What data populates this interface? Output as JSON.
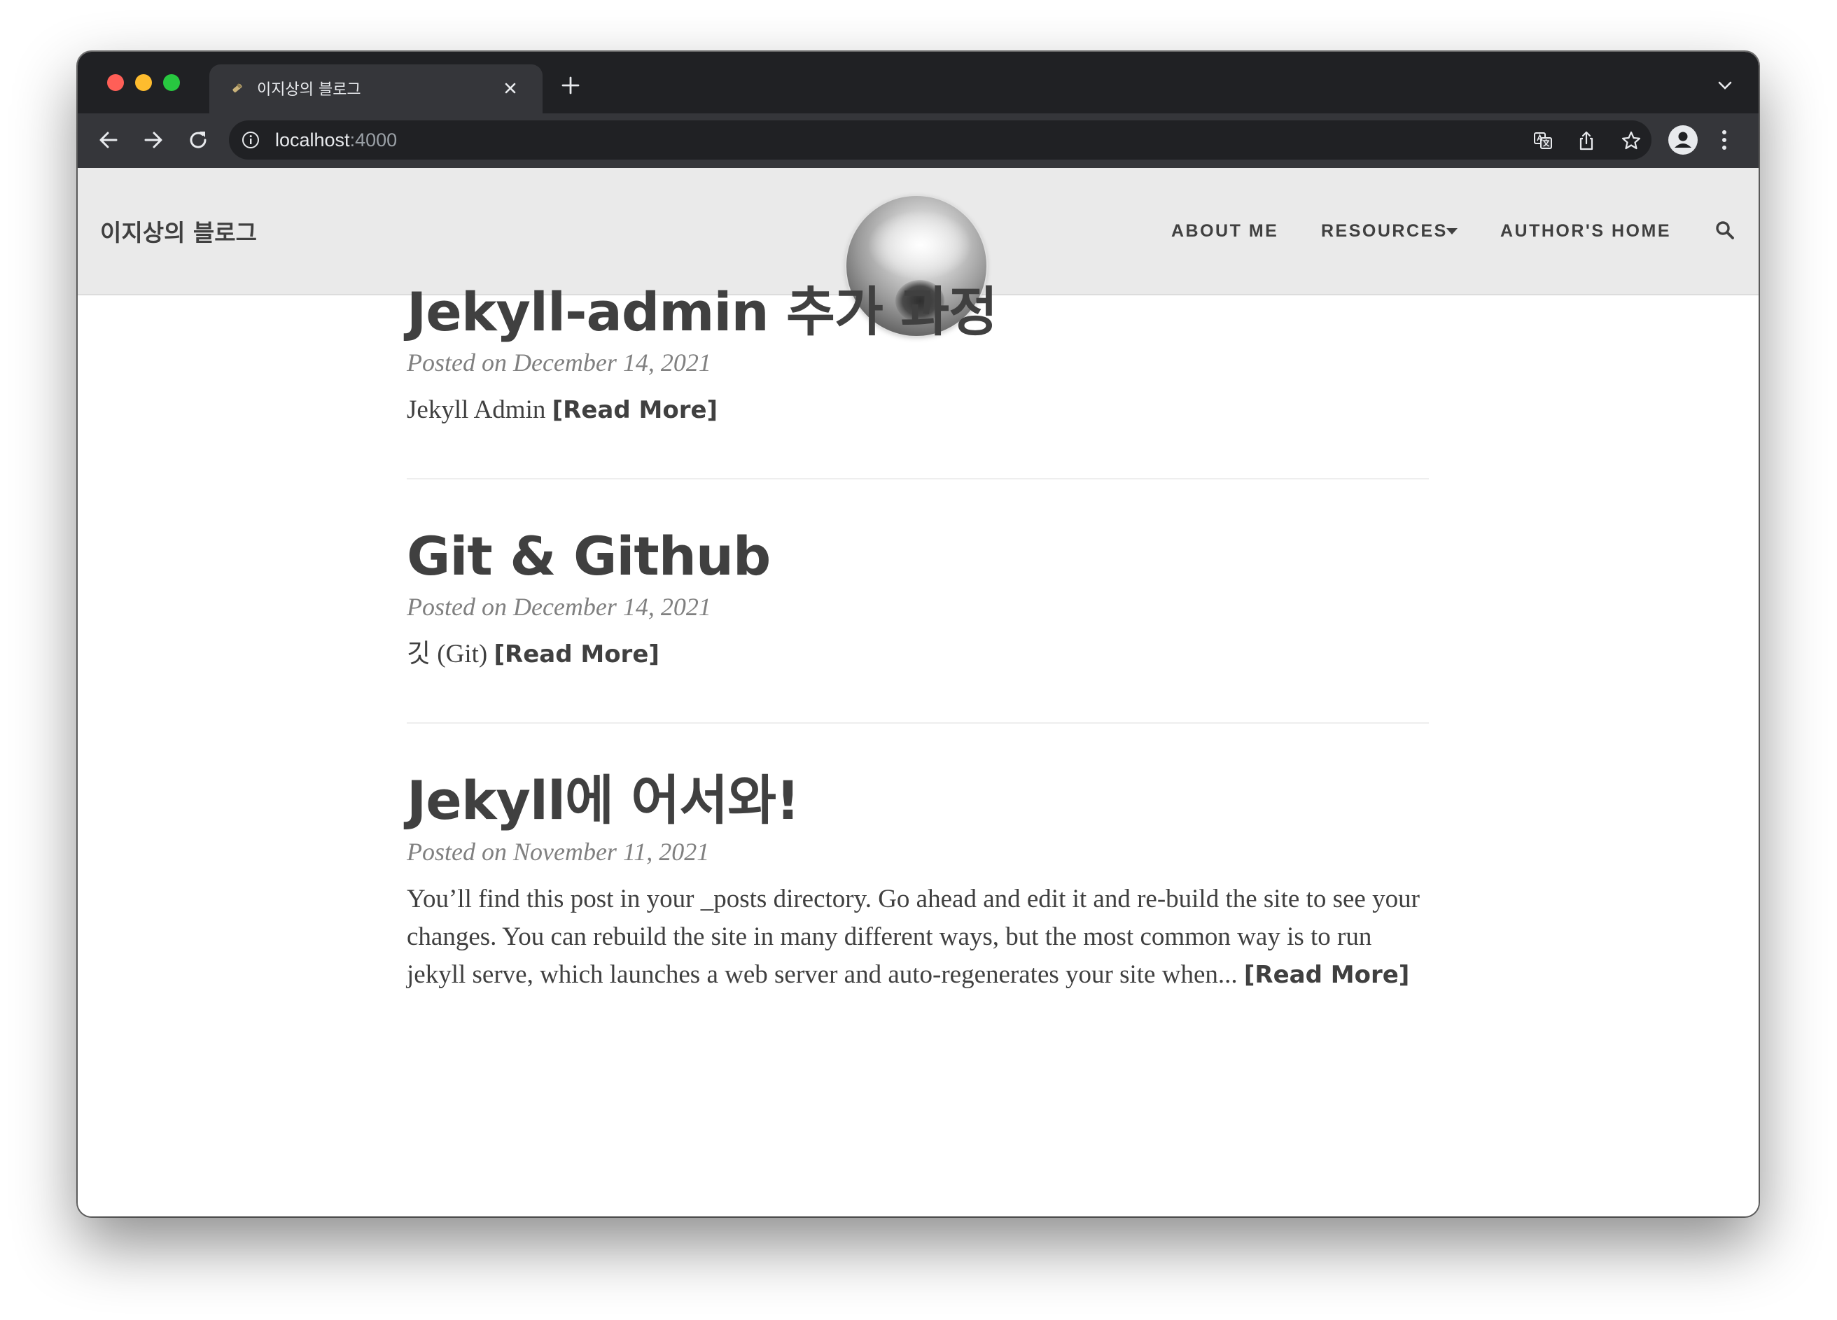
{
  "browser": {
    "tab_title": "이지상의 블로그",
    "url_host": "localhost",
    "url_port": ":4000"
  },
  "navbar": {
    "brand": "이지상의 블로그",
    "links": [
      {
        "label": "ABOUT ME"
      },
      {
        "label": "RESOURCES"
      },
      {
        "label": "AUTHOR'S HOME"
      }
    ]
  },
  "posts": [
    {
      "title": "Jekyll-admin 추가 과정",
      "meta": "Posted on December 14, 2021",
      "excerpt": "Jekyll Admin ",
      "read_more": "[Read More]"
    },
    {
      "title": "Git & Github",
      "meta": "Posted on December 14, 2021",
      "excerpt": "깃 (Git) ",
      "read_more": "[Read More]"
    },
    {
      "title": "Jekyll에 어서와!",
      "meta": "Posted on November 11, 2021",
      "excerpt": "You’ll find this post in your _posts directory. Go ahead and edit it and re-build the site to see your changes. You can rebuild the site in many different ways, but the most common way is to run jekyll serve, which launches a web server and auto-regenerates your site when... ",
      "read_more": "[Read More]"
    }
  ]
}
